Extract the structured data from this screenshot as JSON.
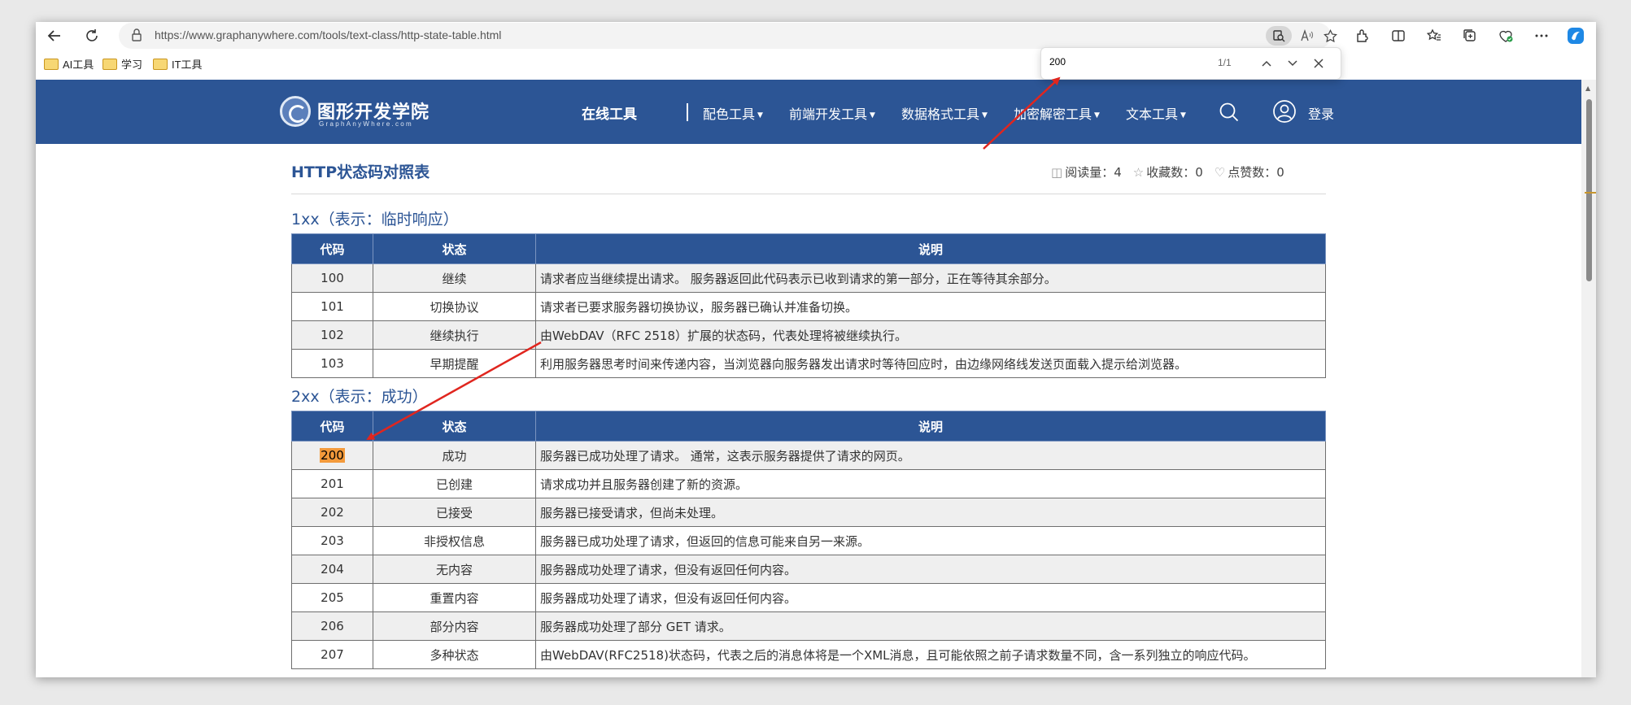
{
  "browser": {
    "url_host": "https://www.graphanywhere.com",
    "url_path": "/tools/text-class/http-state-table.html",
    "bookmarks": [
      "AI工具",
      "学习",
      "IT工具"
    ],
    "find": {
      "query": "200",
      "count": "1/1"
    }
  },
  "header": {
    "logo_title": "图形开发学院",
    "logo_subtitle": "GraphAnyWhere.com",
    "nav_online": "在线工具",
    "nav_items": [
      "配色工具",
      "前端开发工具",
      "数据格式工具",
      "加密解密工具",
      "文本工具"
    ],
    "login": "登录"
  },
  "page": {
    "title": "HTTP状态码对照表",
    "stats": {
      "views_label": "阅读量：",
      "views": "4",
      "favorites_label": "收藏数：",
      "favorites": "0",
      "likes_label": "点赞数：",
      "likes": "0"
    },
    "headers": {
      "code": "代码",
      "status": "状态",
      "desc": "说明"
    },
    "sections": [
      {
        "title": "1xx（表示：临时响应）",
        "rows": [
          {
            "code": "100",
            "status": "继续",
            "desc": "请求者应当继续提出请求。 服务器返回此代码表示已收到请求的第一部分，正在等待其余部分。"
          },
          {
            "code": "101",
            "status": "切换协议",
            "desc": "请求者已要求服务器切换协议，服务器已确认并准备切换。"
          },
          {
            "code": "102",
            "status": "继续执行",
            "desc": "由WebDAV（RFC 2518）扩展的状态码，代表处理将被继续执行。"
          },
          {
            "code": "103",
            "status": "早期提醒",
            "desc": "利用服务器思考时间来传递内容，当浏览器向服务器发出请求时等待回应时，由边缘网络线发送页面载入提示给浏览器。"
          }
        ]
      },
      {
        "title": "2xx（表示：成功）",
        "rows": [
          {
            "code": "200",
            "status": "成功",
            "desc": "服务器已成功处理了请求。 通常，这表示服务器提供了请求的网页。"
          },
          {
            "code": "201",
            "status": "已创建",
            "desc": "请求成功并且服务器创建了新的资源。"
          },
          {
            "code": "202",
            "status": "已接受",
            "desc": "服务器已接受请求，但尚未处理。"
          },
          {
            "code": "203",
            "status": "非授权信息",
            "desc": "服务器已成功处理了请求，但返回的信息可能来自另一来源。"
          },
          {
            "code": "204",
            "status": "无内容",
            "desc": "服务器成功处理了请求，但没有返回任何内容。"
          },
          {
            "code": "205",
            "status": "重置内容",
            "desc": "服务器成功处理了请求，但没有返回任何内容。"
          },
          {
            "code": "206",
            "status": "部分内容",
            "desc": "服务器成功处理了部分 GET 请求。"
          },
          {
            "code": "207",
            "status": "多种状态",
            "desc": "由WebDAV(RFC2518)状态码，代表之后的消息体将是一个XML消息，且可能依照之前子请求数量不同，含一系列独立的响应代码。"
          }
        ]
      }
    ]
  },
  "colors": {
    "brand": "#2c5595",
    "highlight": "#f39a3b",
    "annotation_arrow": "#e0261f"
  }
}
